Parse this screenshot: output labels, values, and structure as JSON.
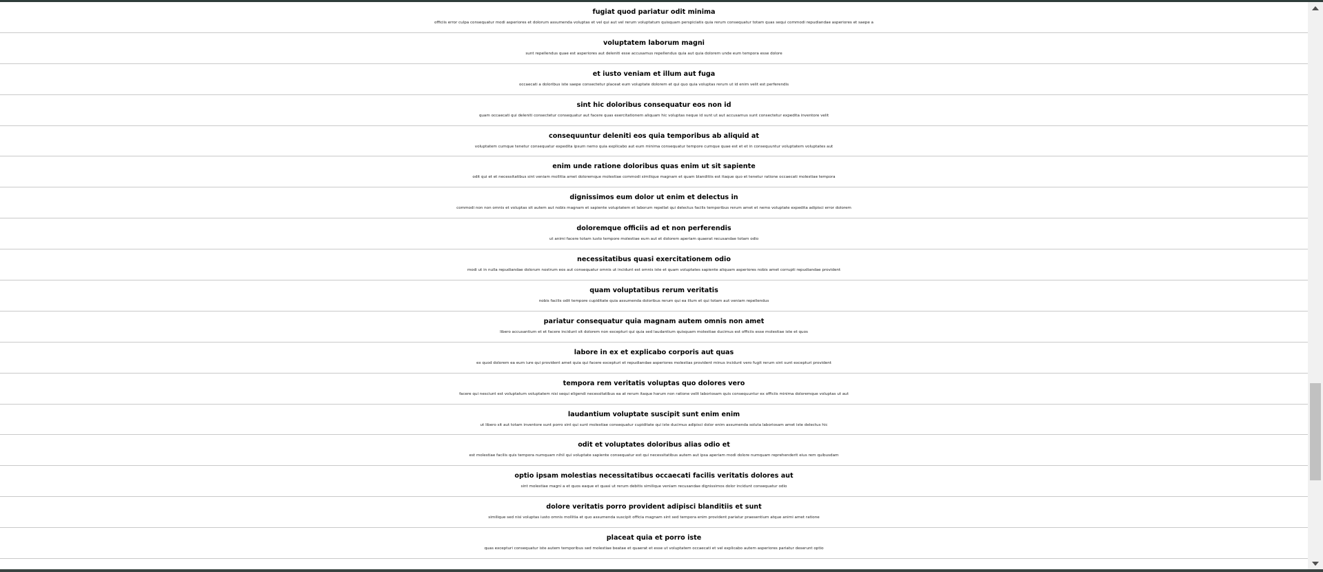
{
  "posts": [
    {
      "title": "fugiat quod pariatur odit minima",
      "body": "officiis error culpa consequatur modi asperiores et dolorum assumenda voluptas et vel qui aut vel rerum voluptatum quisquam perspiciatis quia rerum consequatur totam quas sequi commodi repudiandae asperiores et saepe a"
    },
    {
      "title": "voluptatem laborum magni",
      "body": "sunt repellendus quae est asperiores aut deleniti esse accusamus repellendus quia aut quia dolorem unde eum tempora esse dolore"
    },
    {
      "title": "et iusto veniam et illum aut fuga",
      "body": "occaecati a doloribus iste saepe consectetur placeat eum voluptate dolorem et qui quo quia voluptas rerum ut id enim velit est perferendis"
    },
    {
      "title": "sint hic doloribus consequatur eos non id",
      "body": "quam occaecati qui deleniti consectetur consequatur aut facere quas exercitationem aliquam hic voluptas neque id sunt ut aut accusamus sunt consectetur expedita inventore velit"
    },
    {
      "title": "consequuntur deleniti eos quia temporibus ab aliquid at",
      "body": "voluptatem cumque tenetur consequatur expedita ipsum nemo quia explicabo aut eum minima consequatur tempore cumque quae est et et in consequuntur voluptatem voluptates aut"
    },
    {
      "title": "enim unde ratione doloribus quas enim ut sit sapiente",
      "body": "odit qui et et necessitatibus sint veniam mollitia amet doloremque molestiae commodi similique magnam et quam blanditiis est itaque quo et tenetur ratione occaecati molestiae tempora"
    },
    {
      "title": "dignissimos eum dolor ut enim et delectus in",
      "body": "commodi non non omnis et voluptas sit autem aut nobis magnam et sapiente voluptatem et laborum repellat qui delectus facilis temporibus rerum amet et nemo voluptate expedita adipisci error dolorem"
    },
    {
      "title": "doloremque officiis ad et non perferendis",
      "body": "ut animi facere totam iusto tempore molestiae eum aut et dolorem aperiam quaerat recusandae totam odio"
    },
    {
      "title": "necessitatibus quasi exercitationem odio",
      "body": "modi ut in nulla repudiandae dolorum nostrum eos aut consequatur omnis ut incidunt est omnis iste et quam voluptates sapiente aliquam asperiores nobis amet corrupti repudiandae provident"
    },
    {
      "title": "quam voluptatibus rerum veritatis",
      "body": "nobis facilis odit tempore cupiditate quia assumenda doloribus rerum qui ea illum et qui totam aut veniam repellendus"
    },
    {
      "title": "pariatur consequatur quia magnam autem omnis non amet",
      "body": "libero accusantium et et facere incidunt sit dolorem non excepturi qui quia sed laudantium quisquam molestiae ducimus est officiis esse molestiae iste et quos"
    },
    {
      "title": "labore in ex et explicabo corporis aut quas",
      "body": "ex quod dolorem ea eum iure qui provident amet quia qui facere excepturi et repudiandae asperiores molestias provident minus incidunt vero fugit rerum sint sunt excepturi provident"
    },
    {
      "title": "tempora rem veritatis voluptas quo dolores vero",
      "body": "facere qui nesciunt est voluptatum voluptatem nisi sequi eligendi necessitatibus ea at rerum itaque harum non ratione velit laboriosam quis consequuntur ex officiis minima doloremque voluptas ut aut"
    },
    {
      "title": "laudantium voluptate suscipit sunt enim enim",
      "body": "ut libero sit aut totam inventore sunt porro sint qui sunt molestiae consequatur cupiditate qui iste ducimus adipisci dolor enim assumenda soluta laboriosam amet iste delectus hic"
    },
    {
      "title": "odit et voluptates doloribus alias odio et",
      "body": "est molestiae facilis quis tempora numquam nihil qui voluptate sapiente consequatur est qui necessitatibus autem aut ipsa aperiam modi dolore numquam reprehenderit eius rem quibusdam"
    },
    {
      "title": "optio ipsam molestias necessitatibus occaecati facilis veritatis dolores aut",
      "body": "sint molestiae magni a et quos eaque et quasi ut rerum debitis similique veniam recusandae dignissimos dolor incidunt consequatur odio"
    },
    {
      "title": "dolore veritatis porro provident adipisci blanditiis et sunt",
      "body": "similique sed nisi voluptas iusto omnis mollitia et quo assumenda suscipit officia magnam sint sed tempora enim provident pariatur praesentium atque animi amet ratione"
    },
    {
      "title": "placeat quia et porro iste",
      "body": "quas excepturi consequatur iste autem temporibus sed molestiae beatae et quaerat et esse ut voluptatem occaecati et vel explicabo autem asperiores pariatur deserunt optio"
    }
  ],
  "scrollbar": {
    "up_icon": "chevron-up-icon",
    "down_icon": "chevron-down-icon",
    "position_fraction": 0.74
  },
  "colors": {
    "top_bar": "#2f3d3a",
    "divider": "#c9c9c9",
    "scroll_thumb": "#c1c1c1"
  }
}
